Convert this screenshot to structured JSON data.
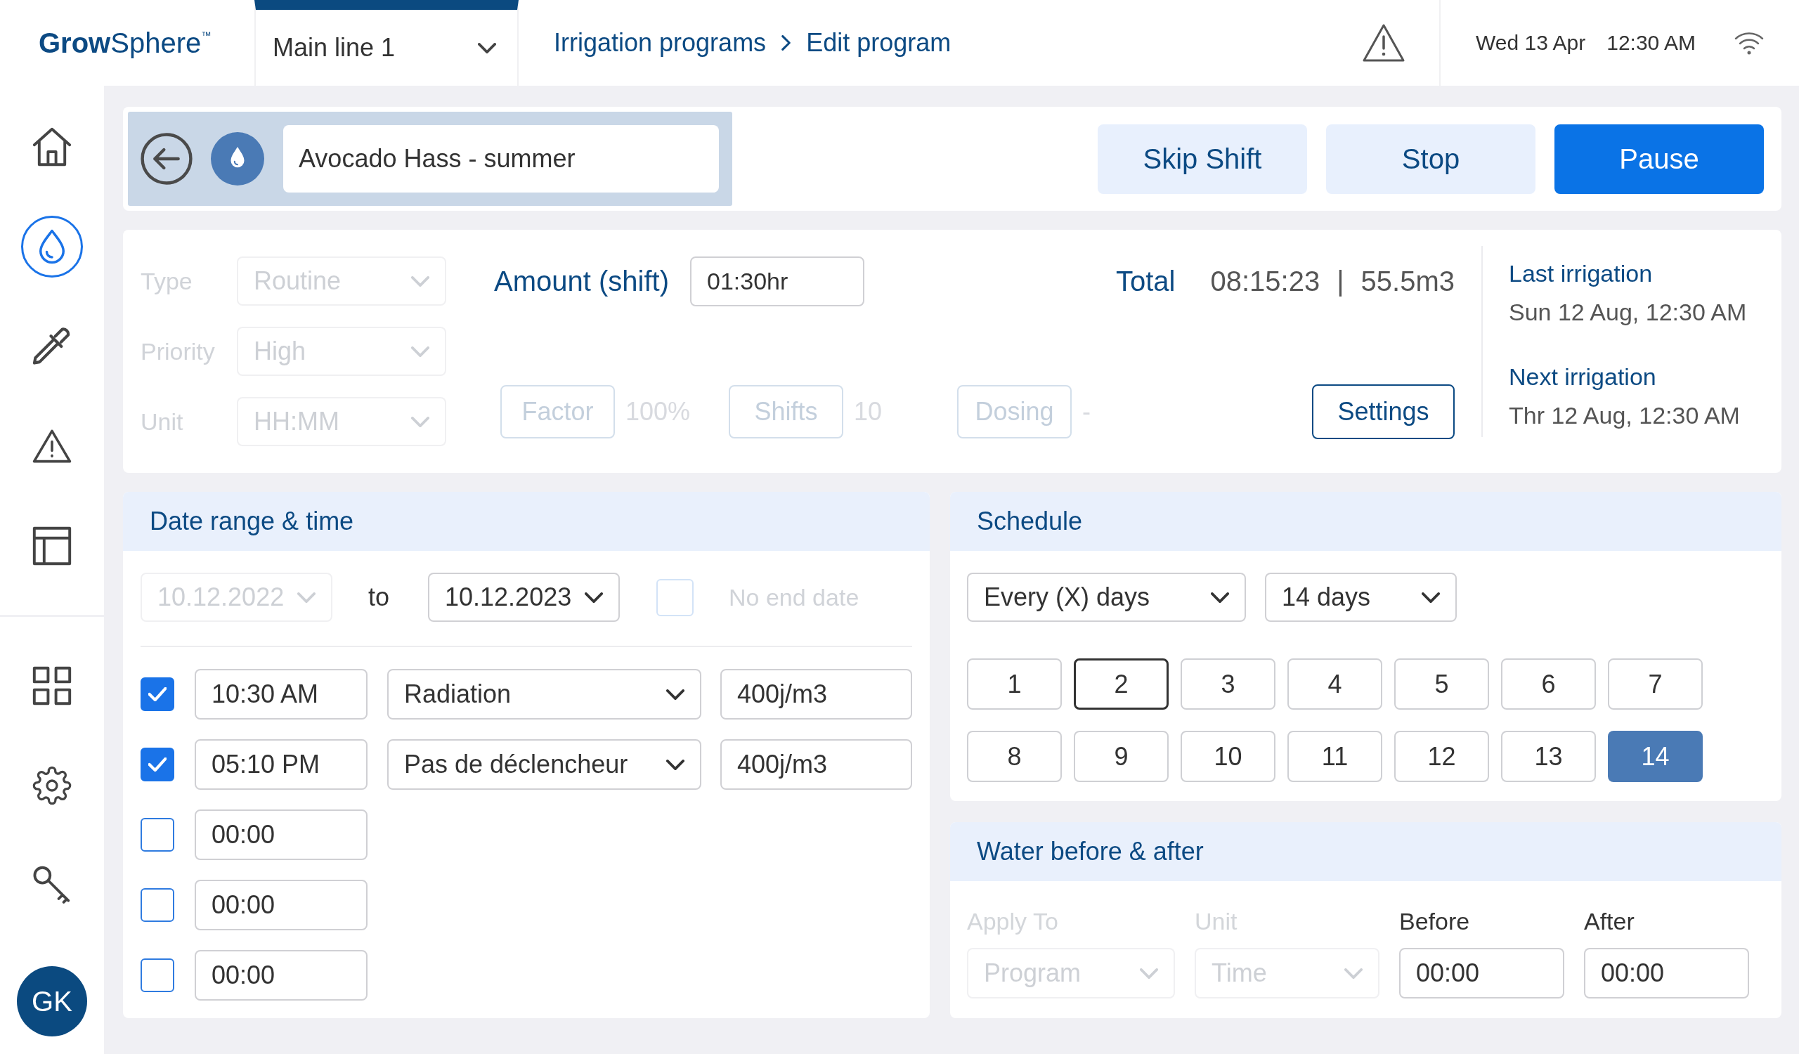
{
  "top_bar": {
    "logo": "**Grow**Sphere$^{™}$",
    "line_selector": "Main line 1",
    "breadcrumb": [
      "Irrigation programs",
      "Edit program"
    ],
    "date": "Wed 13 Apr",
    "time": "12:30 AM"
  },
  "sidebar": {
    "groups": [
      {
        "items": [
          {
            "selected": false
          },
          {
            "selected": true
          },
          {
            "selected": false
          },
          {
            "selected": false
          },
          {
            "selected": false
          }
        ]
      },
      {
        "items": [
          {
            "selected": false
          },
          {
            "selected": false
          },
          {
            "selected": false
          }
        ]
      }
    ],
    "avatar": "GK"
  },
  "program_bar": {
    "name": "Avocado Hass - summer",
    "buttons": [
      {
        "label": "Skip Shift",
        "kind": "secondary"
      },
      {
        "label": "Stop",
        "kind": "secondary"
      },
      {
        "label": "Pause",
        "kind": "primary"
      }
    ]
  },
  "program_settings": {
    "fields": [
      {
        "label": "Type",
        "value": "Routine",
        "disabled": true
      },
      {
        "label": "Priority",
        "value": "High",
        "disabled": true
      },
      {
        "label": "Unit",
        "value": "HH:MM",
        "disabled": true
      }
    ],
    "amount": {
      "label": "Amount (shift)",
      "value": "01:30hr"
    },
    "total": {
      "label": "Total",
      "duration": "08:15:23",
      "separator": "|",
      "volume": "55.5m3"
    },
    "options": [
      {
        "label": "Factor",
        "value": "100%",
        "disabled": true
      },
      {
        "label": "Shifts",
        "value": "10",
        "disabled": true
      },
      {
        "label": "Dosing",
        "value": "-",
        "disabled": true
      }
    ],
    "settings_button": "Settings",
    "last_irrigation": {
      "label": "Last irrigation",
      "value": "Sun 12 Aug, 12:30 AM"
    },
    "next_irrigation": {
      "label": "Next irrigation",
      "value": "Thr 12 Aug, 12:30 AM"
    }
  },
  "date_range": {
    "title": "Date range & time",
    "start": {
      "value": "10.12.2022",
      "disabled": true
    },
    "to_label": "to",
    "end": {
      "value": "10.12.2023",
      "disabled": false
    },
    "no_end_date": {
      "label": "No end date",
      "checked": false,
      "disabled": true
    },
    "times": [
      {
        "checked": true,
        "time": "10:30 AM",
        "trigger": "Radiation",
        "amount": "400j/m3"
      },
      {
        "checked": true,
        "time": "05:10 PM",
        "trigger": "Pas de déclencheur",
        "amount": "400j/m3"
      },
      {
        "checked": false,
        "time": "00:00"
      },
      {
        "checked": false,
        "time": "00:00"
      },
      {
        "checked": false,
        "time": "00:00"
      }
    ]
  },
  "schedule": {
    "title": "Schedule",
    "mode": "Every (X) days",
    "interval": "14 days",
    "days": [
      {
        "label": "1",
        "selected": false,
        "focused": false
      },
      {
        "label": "2",
        "selected": false,
        "focused": true
      },
      {
        "label": "3",
        "selected": false,
        "focused": false
      },
      {
        "label": "4",
        "selected": false,
        "focused": false
      },
      {
        "label": "5",
        "selected": false,
        "focused": false
      },
      {
        "label": "6",
        "selected": false,
        "focused": false
      },
      {
        "label": "7",
        "selected": false,
        "focused": false
      },
      {
        "label": "8",
        "selected": false,
        "focused": false
      },
      {
        "label": "9",
        "selected": false,
        "focused": false
      },
      {
        "label": "10",
        "selected": false,
        "focused": false
      },
      {
        "label": "11",
        "selected": false,
        "focused": false
      },
      {
        "label": "12",
        "selected": false,
        "focused": false
      },
      {
        "label": "13",
        "selected": false,
        "focused": false
      },
      {
        "label": "14",
        "selected": true,
        "focused": false
      }
    ]
  },
  "water_before_after": {
    "title": "Water before & after",
    "fields": [
      {
        "label": "Apply To",
        "value": "Program",
        "kind": "dropdown",
        "disabled": true
      },
      {
        "label": "Unit",
        "value": "Time",
        "kind": "dropdown",
        "disabled": true
      },
      {
        "label": "Before",
        "value": "00:00",
        "kind": "input",
        "disabled": false
      },
      {
        "label": "After",
        "value": "00:00",
        "kind": "input",
        "disabled": false
      }
    ]
  }
}
